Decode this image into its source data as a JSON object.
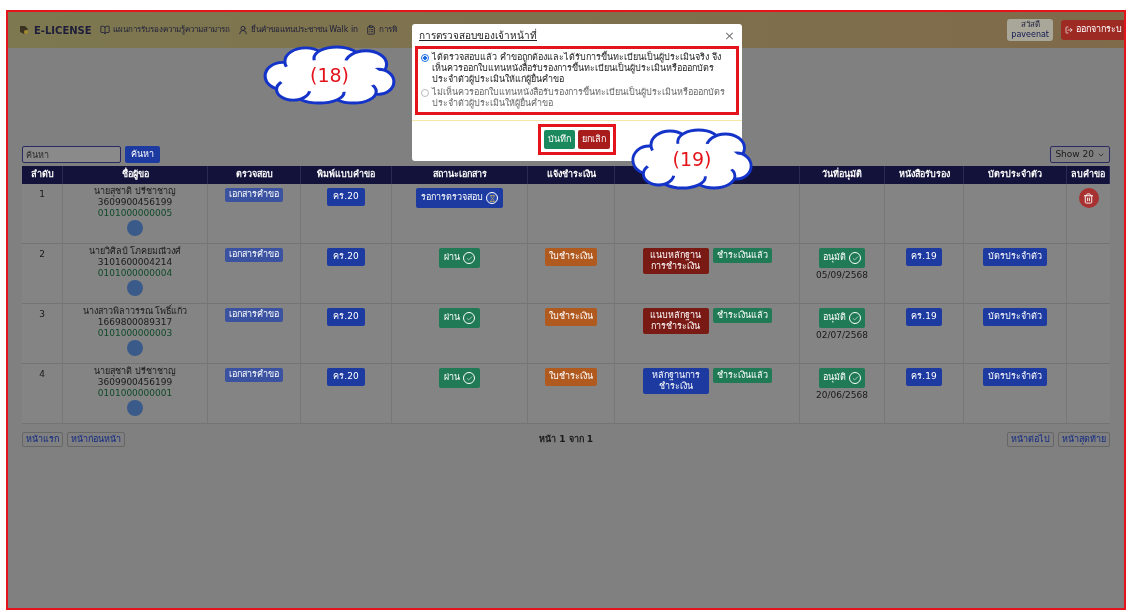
{
  "nav": {
    "brand": "E-LICENSE",
    "items": [
      {
        "label": "แผนการรับรองความรู้ความสามารถ",
        "kind": "book"
      },
      {
        "label": "ยื่นคำขอแทนประชาชน Walk in",
        "kind": "user"
      },
      {
        "label": "การพิ",
        "kind": "clipboard"
      }
    ],
    "user": {
      "greeting": "สวัสดี",
      "name": "paveenat"
    },
    "logout": "ออกจากระบ"
  },
  "search": {
    "placeholder": "ค้นหา",
    "button": "ค้นหา",
    "page_size": "Show 20"
  },
  "table": {
    "columns": [
      "ลำดับ",
      "ชื่อผู้ขอ",
      "ตรวจสอบ",
      "พิมพ์แบบคำขอ",
      "สถานะเอกสาร",
      "แจ้งชำระเงิน",
      "",
      "วันที่อนุมัติ",
      "หนังสือรับรอง",
      "บัตรประจำตัว",
      "ลบคำขอ"
    ],
    "rows": [
      {
        "index": "1",
        "name": "นายสุชาติ ปรีชาชาญ",
        "id_number": "3609900456199",
        "code": "0101000000005",
        "check": "เอกสารคำขอ",
        "form": "คร.20",
        "status": {
          "label": "รอการตรวจสอบ",
          "kind": "pending"
        },
        "deletable": true
      },
      {
        "index": "2",
        "name": "นายวิศิลป์ โภคยมณีวงศ์",
        "id_number": "3101600004214",
        "code": "0101000000004",
        "check": "เอกสารคำขอ",
        "form": "คร.20",
        "status": {
          "label": "ผ่าน",
          "kind": "passed"
        },
        "invoice": "ใบชำระเงิน",
        "payment_actions": [
          {
            "label": "แนบหลักฐานการชำระเงิน",
            "kind": "attach"
          },
          {
            "label": "ชำระเงินแล้ว",
            "kind": "paid"
          }
        ],
        "approval": {
          "label": "อนุมัติ",
          "date": "05/09/2568"
        },
        "certificate": "คร.19",
        "id_card": "บัตรประจำตัว",
        "deletable": false
      },
      {
        "index": "3",
        "name": "นางสาวพิลาวรรณ โพธิ์แก้ว",
        "id_number": "1669800089317",
        "code": "0101000000003",
        "check": "เอกสารคำขอ",
        "form": "คร.20",
        "status": {
          "label": "ผ่าน",
          "kind": "passed"
        },
        "invoice": "ใบชำระเงิน",
        "payment_actions": [
          {
            "label": "แนบหลักฐานการชำระเงิน",
            "kind": "attach"
          },
          {
            "label": "ชำระเงินแล้ว",
            "kind": "paid"
          }
        ],
        "approval": {
          "label": "อนุมัติ",
          "date": "02/07/2568"
        },
        "certificate": "คร.19",
        "id_card": "บัตรประจำตัว",
        "deletable": false
      },
      {
        "index": "4",
        "name": "นายสุชาติ ปรีชาชาญ",
        "id_number": "3609900456199",
        "code": "0101000000001",
        "check": "เอกสารคำขอ",
        "form": "คร.20",
        "status": {
          "label": "ผ่าน",
          "kind": "passed"
        },
        "invoice": "ใบชำระเงิน",
        "payment_actions": [
          {
            "label": "หลักฐานการชำระเงิน",
            "kind": "proof"
          },
          {
            "label": "ชำระเงินแล้ว",
            "kind": "paid"
          }
        ],
        "approval": {
          "label": "อนุมัติ",
          "date": "20/06/2568"
        },
        "certificate": "คร.19",
        "id_card": "บัตรประจำตัว",
        "deletable": false
      }
    ]
  },
  "pagination": {
    "first": "หน้าแรก",
    "previous": "หน้าก่อนหน้า",
    "info": "หน้า 1 จาก 1",
    "next": "หน้าต่อไป",
    "last": "หน้าสุดท้าย"
  },
  "modal": {
    "title": "การตรวจสอบของเจ้าหน้าที่",
    "close": "×",
    "options": [
      {
        "label": "ได้ตรวจสอบแล้ว คำขอถูกต้องและได้รับการขึ้นทะเบียนเป็นผู้ประเมินจริง จึงเห็นควรออกใบแทนหนังสือรับรองการขึ้นทะเบียนเป็นผู้ประเมินหรือออกบัตรประจำตัวผู้ประเมินให้แก่ผู้ยื่นคำขอ",
        "selected": true
      },
      {
        "label": "ไม่เห็นควรออกใบแทนหนังสือรับรองการขึ้นทะเบียนเป็นผู้ประเมินหรือออกบัตรประจำตัวผู้ประเมินให้ผู้ยื่นคำขอ",
        "selected": false
      }
    ],
    "buttons": [
      {
        "label": "บันทึก",
        "kind": "save"
      },
      {
        "label": "ยกเลิก",
        "kind": "cancel"
      }
    ]
  },
  "callouts": [
    {
      "label": "(18)"
    },
    {
      "label": "(19)"
    }
  ]
}
